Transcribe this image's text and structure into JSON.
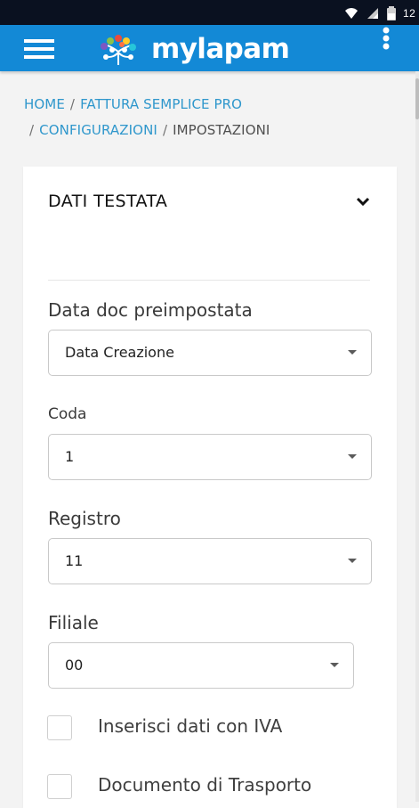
{
  "status_bar": {
    "time": "12"
  },
  "header": {
    "menu_icon": "hamburger-menu-icon",
    "logo_icon": "tree-logo-icon",
    "brand": "mylapam",
    "overflow_icon": "vertical-ellipsis-icon",
    "background_color": "#1389d6"
  },
  "breadcrumb": {
    "items": [
      {
        "label": "HOME"
      },
      {
        "label": "FATTURA SEMPLICE PRO"
      },
      {
        "label": "CONFIGURAZIONI"
      },
      {
        "label": "IMPOSTAZIONI"
      }
    ],
    "separator": "/",
    "link_color": "#2f97cc"
  },
  "section": {
    "title": "DATI TESTATA",
    "toggle_icon": "chevron-down-icon"
  },
  "fields": {
    "data_doc": {
      "label": "Data doc preimpostata",
      "value": "Data Creazione"
    },
    "coda": {
      "label": "Coda",
      "value": "1"
    },
    "registro": {
      "label": "Registro",
      "value": "11"
    },
    "filiale": {
      "label": "Filiale",
      "value": "00"
    }
  },
  "checkboxes": [
    {
      "label": "Inserisci dati con IVA",
      "checked": false
    },
    {
      "label": "Documento di Trasporto",
      "checked": false
    }
  ]
}
